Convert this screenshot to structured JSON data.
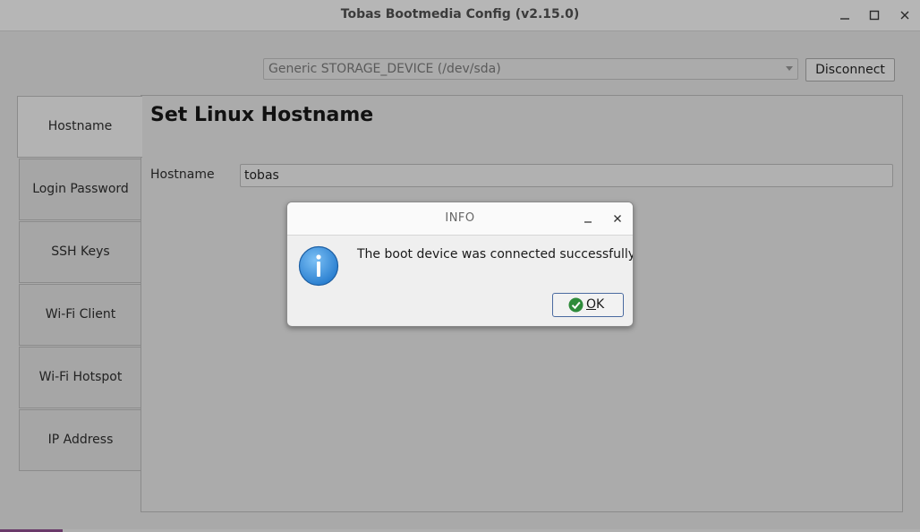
{
  "window": {
    "title": "Tobas Bootmedia Config (v2.15.0)"
  },
  "toolbar": {
    "device_value": "Generic STORAGE_DEVICE (/dev/sda)",
    "disconnect_label": "Disconnect"
  },
  "sidebar": {
    "items": [
      {
        "label": "Hostname",
        "active": true
      },
      {
        "label": "Login Password",
        "active": false
      },
      {
        "label": "SSH Keys",
        "active": false
      },
      {
        "label": "Wi-Fi Client",
        "active": false
      },
      {
        "label": "Wi-Fi Hotspot",
        "active": false
      },
      {
        "label": "IP Address",
        "active": false
      }
    ]
  },
  "main": {
    "title": "Set Linux Hostname",
    "hostname_label": "Hostname",
    "hostname_value": "tobas"
  },
  "dialog": {
    "title": "INFO",
    "message": "The boot device was connected successfully.",
    "ok_mnemonic": "O",
    "ok_rest": "K"
  },
  "colors": {
    "ok_border": "#4a6aa0",
    "info_icon": "#2a7fd0",
    "check_icon": "#2e8b3a"
  }
}
